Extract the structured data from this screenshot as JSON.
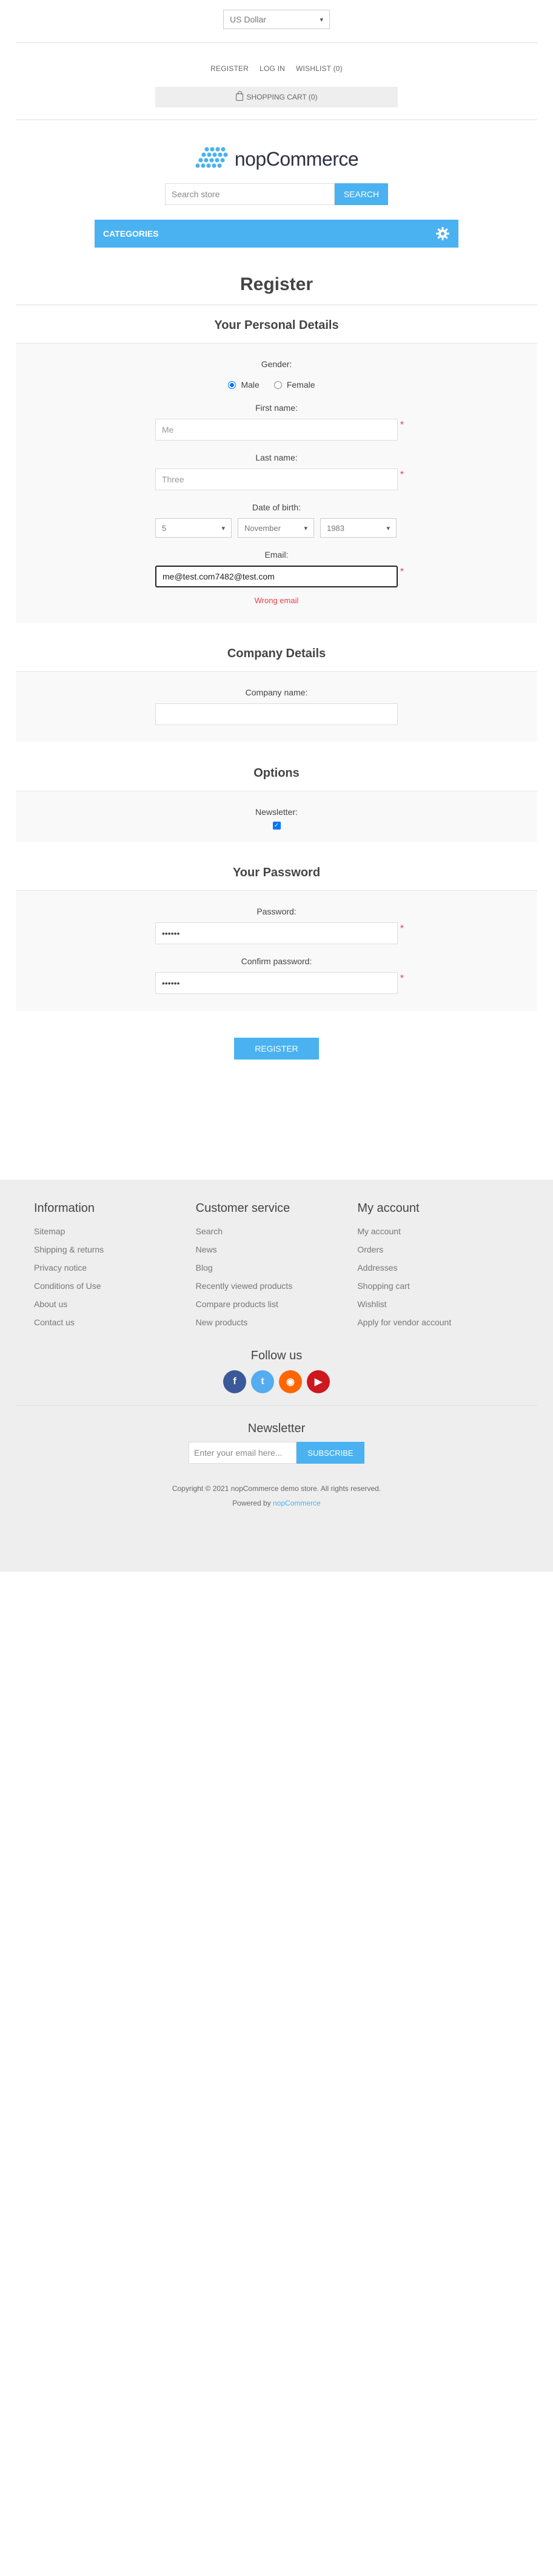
{
  "header": {
    "currency": "US Dollar",
    "links": [
      "REGISTER",
      "LOG IN",
      "WISHLIST (0)"
    ],
    "cart": "SHOPPING CART (0)"
  },
  "logo": {
    "brand": "nopCommerce"
  },
  "search": {
    "placeholder": "Search store",
    "button": "SEARCH"
  },
  "categories": {
    "label": "CATEGORIES"
  },
  "page_title": "Register",
  "personal": {
    "title": "Your Personal Details",
    "gender_label": "Gender:",
    "male": "Male",
    "female": "Female",
    "first_name_label": "First name:",
    "first_name_value": "Me",
    "last_name_label": "Last name:",
    "last_name_value": "Three",
    "dob_label": "Date of birth:",
    "dob_day": "5",
    "dob_month": "November",
    "dob_year": "1983",
    "email_label": "Email:",
    "email_value": "me@test.com7482@test.com",
    "email_error": "Wrong email"
  },
  "company": {
    "title": "Company Details",
    "name_label": "Company name:"
  },
  "options": {
    "title": "Options",
    "newsletter_label": "Newsletter:"
  },
  "password": {
    "title": "Your Password",
    "password_label": "Password:",
    "password_value": "••••••",
    "confirm_label": "Confirm password:",
    "confirm_value": "••••••"
  },
  "register_button": "REGISTER",
  "footer": {
    "columns": [
      {
        "title": "Information",
        "items": [
          "Sitemap",
          "Shipping & returns",
          "Privacy notice",
          "Conditions of Use",
          "About us",
          "Contact us"
        ]
      },
      {
        "title": "Customer service",
        "items": [
          "Search",
          "News",
          "Blog",
          "Recently viewed products",
          "Compare products list",
          "New products"
        ]
      },
      {
        "title": "My account",
        "items": [
          "My account",
          "Orders",
          "Addresses",
          "Shopping cart",
          "Wishlist",
          "Apply for vendor account"
        ]
      }
    ],
    "follow_title": "Follow us",
    "newsletter_title": "Newsletter",
    "newsletter_placeholder": "Enter your email here...",
    "subscribe": "SUBSCRIBE",
    "copyright": "Copyright © 2021 nopCommerce demo store. All rights reserved.",
    "powered_prefix": "Powered by",
    "powered_link": "nopCommerce"
  },
  "colors": {
    "accent": "#4ab2f1",
    "error": "#e4434b"
  }
}
